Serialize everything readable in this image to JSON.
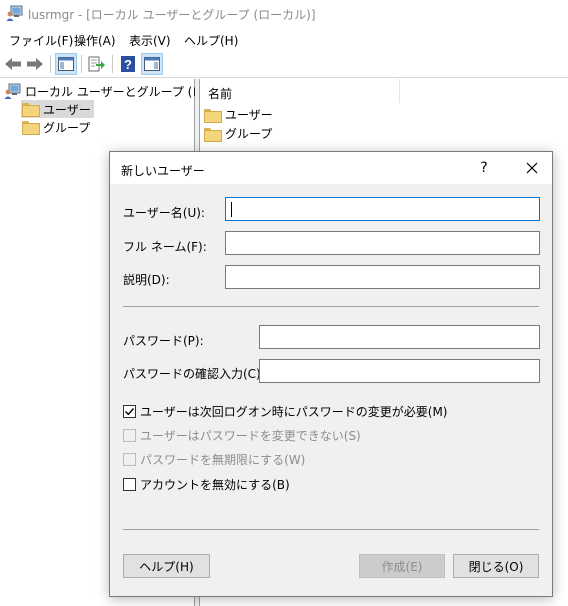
{
  "window": {
    "title": "lusrmgr - [ローカル ユーザーとグループ (ローカル)]",
    "icon": "users-computer-icon"
  },
  "menu": {
    "file": "ファイル(F)",
    "action": "操作(A)",
    "view": "表示(V)",
    "help": "ヘルプ(H)"
  },
  "toolbar": {
    "buttons": [
      "back-arrow-icon",
      "forward-arrow-icon",
      "show-hide-console-tree-icon",
      "export-list-icon",
      "help-icon",
      "show-hide-action-pane-icon"
    ]
  },
  "tree": {
    "root": "ローカル ユーザーとグループ (ローカル)",
    "items": [
      {
        "label": "ユーザー",
        "selected": true
      },
      {
        "label": "グループ",
        "selected": false
      }
    ]
  },
  "list": {
    "column_name": "名前",
    "items": [
      "ユーザー",
      "グループ"
    ]
  },
  "dialog": {
    "title": "新しいユーザー",
    "help_glyph": "?",
    "username_label": "ユーザー名(U):",
    "username_value": "",
    "fullname_label": "フル ネーム(F):",
    "fullname_value": "",
    "description_label": "説明(D):",
    "description_value": "",
    "password_label": "パスワード(P):",
    "password_value": "",
    "confirm_label": "パスワードの確認入力(C):",
    "confirm_value": "",
    "checks": [
      {
        "label": "ユーザーは次回ログオン時にパスワードの変更が必要(M)",
        "checked": true,
        "enabled": true
      },
      {
        "label": "ユーザーはパスワードを変更できない(S)",
        "checked": false,
        "enabled": false
      },
      {
        "label": "パスワードを無期限にする(W)",
        "checked": false,
        "enabled": false
      },
      {
        "label": "アカウントを無効にする(B)",
        "checked": false,
        "enabled": true
      }
    ],
    "help_button": "ヘルプ(H)",
    "create_button": "作成(E)",
    "close_button": "閉じる(O)"
  },
  "colors": {
    "accent": "#0078d7",
    "folder": "#f5d57c",
    "dialog_bg": "#f0f0f0",
    "disabled_text": "#8d8d8d"
  }
}
